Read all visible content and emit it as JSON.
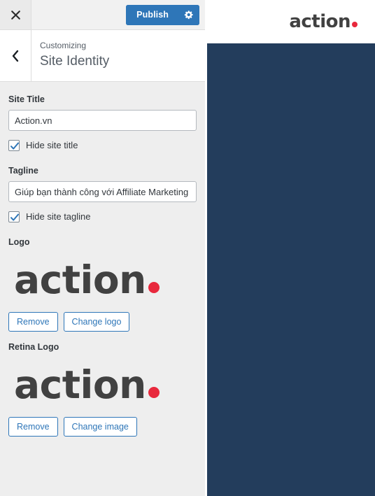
{
  "customizer": {
    "topbar": {
      "close_icon": "close-x-icon",
      "publish_label": "Publish",
      "gear_icon": "gear-icon"
    },
    "panel_header": {
      "back_icon": "chevron-left-icon",
      "eyebrow": "Customizing",
      "title": "Site Identity"
    },
    "controls": {
      "site_title": {
        "label": "Site Title",
        "value": "Action.vn",
        "placeholder": "Site Title"
      },
      "hide_site_title": {
        "label": "Hide site title",
        "checked": true
      },
      "tagline": {
        "label": "Tagline",
        "value": "Giúp bạn thành công với Affiliate Marketing",
        "placeholder": "Tagline"
      },
      "hide_site_tagline": {
        "label": "Hide site tagline",
        "checked": true
      },
      "logo": {
        "label": "Logo",
        "image_alt": "action.",
        "logo_word": "action",
        "remove_label": "Remove",
        "change_label": "Change logo"
      },
      "retina_logo": {
        "label": "Retina Logo",
        "image_alt": "action.",
        "logo_word": "action",
        "remove_label": "Remove",
        "change_label": "Change image"
      }
    }
  },
  "preview": {
    "site_logo_word": "action",
    "site_logo_alt": "action."
  },
  "colors": {
    "publish_blue": "#2e76b8",
    "link_blue": "#2e76b8",
    "logo_gray": "#414141",
    "logo_dot_red": "#e8283c",
    "preview_body_navy": "#233d5c",
    "panel_bg": "#eeeeee"
  }
}
